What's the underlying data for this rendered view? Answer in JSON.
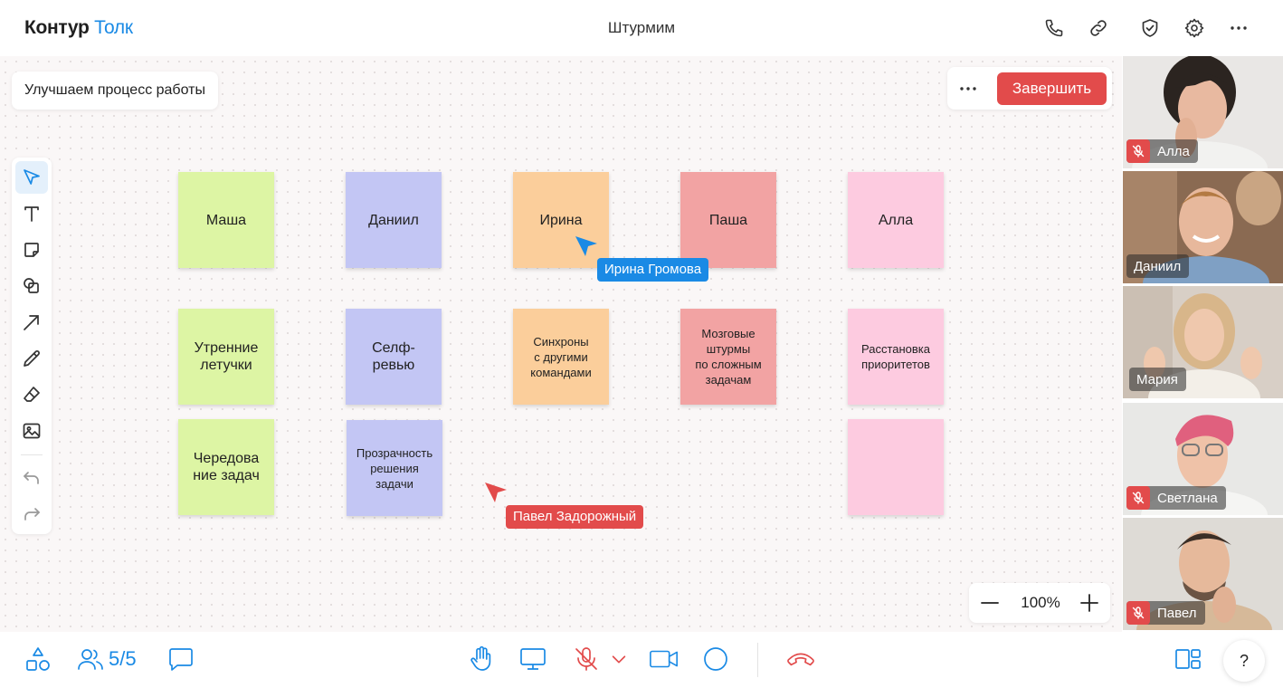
{
  "header": {
    "logo_part1": "Контур",
    "logo_part2": "Толк",
    "meeting_title": "Штурмим"
  },
  "board": {
    "title": "Улучшаем процесс работы",
    "finish_label": "Завершить",
    "zoom_level": "100%",
    "stickies": [
      {
        "text": "Маша",
        "color": "green"
      },
      {
        "text": "Даниил",
        "color": "blue"
      },
      {
        "text": "Ирина",
        "color": "orange"
      },
      {
        "text": "Паша",
        "color": "red"
      },
      {
        "text": "Алла",
        "color": "pink"
      },
      {
        "text": "Утренние\nлетучки",
        "color": "green"
      },
      {
        "text": "Селф-\nревью",
        "color": "blue"
      },
      {
        "text": "Синхроны\nс другими\nкомандами",
        "color": "orange"
      },
      {
        "text": "Мозговые\nштурмы\nпо сложным\nзадачам",
        "color": "red"
      },
      {
        "text": "Расстановка\nприоритетов",
        "color": "pink"
      },
      {
        "text": "Чередова\nние задач",
        "color": "green"
      },
      {
        "text": "Прозрачность\nрешения\nзадачи",
        "color": "blue"
      },
      {
        "text": "",
        "color": "pink"
      }
    ],
    "cursors": [
      {
        "name": "Ирина Громова",
        "color": "#1a8ae5"
      },
      {
        "name": "Павел Задорожный",
        "color": "#e24b4b"
      }
    ]
  },
  "participants": [
    {
      "name": "Алла",
      "muted": true
    },
    {
      "name": "Даниил",
      "muted": false
    },
    {
      "name": "Мария",
      "muted": false,
      "speaking": true
    },
    {
      "name": "Светлана",
      "muted": true
    },
    {
      "name": "Павел",
      "muted": true
    }
  ],
  "bottom": {
    "participants_count": "5/5",
    "help_label": "?"
  },
  "colors": {
    "accent": "#1a8ae5",
    "danger": "#e24b4b",
    "sticky_green": "#ddf5a4",
    "sticky_blue": "#c3c6f4",
    "sticky_orange": "#fbce9b",
    "sticky_red": "#f2a3a3",
    "sticky_pink": "#fdcbe0"
  }
}
